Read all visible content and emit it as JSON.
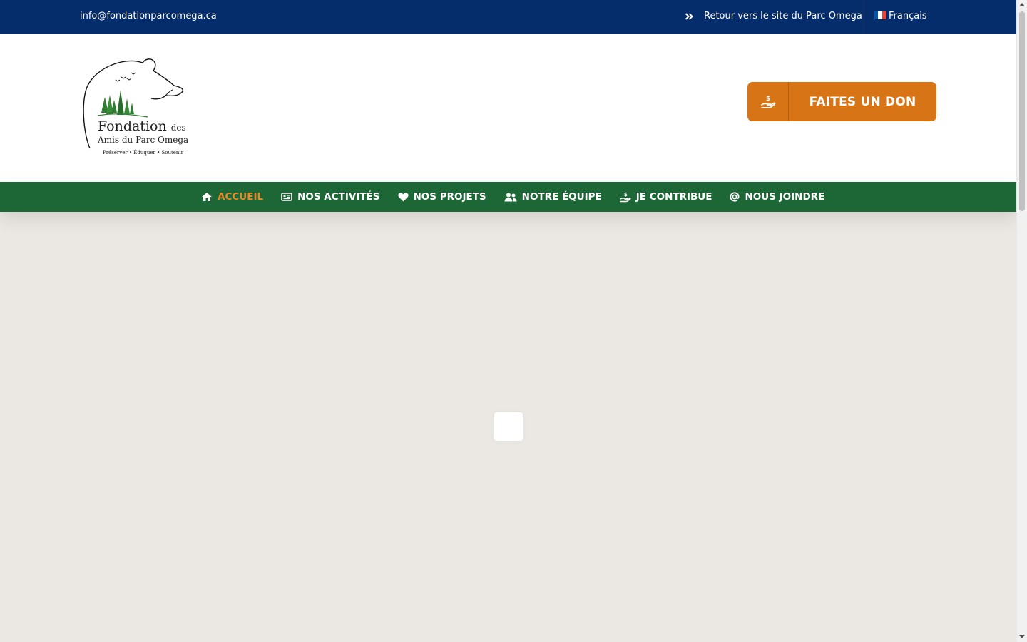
{
  "topbar": {
    "email": "info@fondationparcomega.ca",
    "back_link": "Retour vers le site du Parc Omega",
    "language": "Français",
    "flag_colors": [
      "#0055a4",
      "#ffffff",
      "#ef4135"
    ]
  },
  "logo": {
    "line1": "Fondation",
    "line1_small": "des",
    "line2": "Amis du Parc Omega",
    "tagline": "Préserver • Éduquer • Soutenir"
  },
  "donate": {
    "label": "FAITES UN DON",
    "icon": "hand-holding-dollar-icon"
  },
  "nav": {
    "items": [
      {
        "label": "ACCUEIL",
        "icon": "home-icon",
        "active": true
      },
      {
        "label": "NOS ACTIVITÉS",
        "icon": "newspaper-icon",
        "active": false
      },
      {
        "label": "NOS PROJETS",
        "icon": "heart-icon",
        "active": false
      },
      {
        "label": "NOTRE ÉQUIPE",
        "icon": "users-icon",
        "active": false
      },
      {
        "label": "JE CONTRIBUE",
        "icon": "hand-holding-dollar-icon",
        "active": false
      },
      {
        "label": "NOUS JOINDRE",
        "icon": "at-icon",
        "active": false
      }
    ]
  },
  "colors": {
    "topbar": "#062d6b",
    "nav": "#1d6636",
    "accent": "#d77516",
    "active_nav": "#e08a2a",
    "content_bg": "#ebe8e4"
  }
}
